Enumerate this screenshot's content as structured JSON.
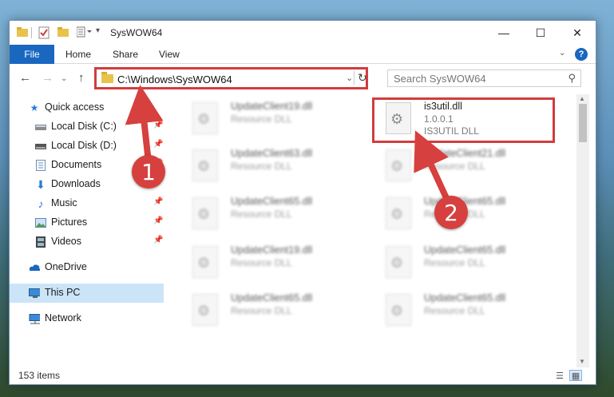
{
  "window": {
    "title": "SysWOW64",
    "controls": {
      "minimize": "—",
      "maximize": "☐",
      "close": "✕"
    }
  },
  "ribbon": {
    "tabs": [
      "File",
      "Home",
      "Share",
      "View"
    ],
    "help": "?"
  },
  "address": {
    "path": "C:\\Windows\\SysWOW64",
    "search_placeholder": "Search SysWOW64"
  },
  "nav": {
    "items": [
      {
        "label": "Quick access",
        "icon": "star-icon",
        "pinned": false
      },
      {
        "label": "Local Disk (C:)",
        "icon": "drive-icon",
        "pinned": true
      },
      {
        "label": "Local Disk (D:)",
        "icon": "drive-icon",
        "pinned": true
      },
      {
        "label": "Documents",
        "icon": "document-icon",
        "pinned": true
      },
      {
        "label": "Downloads",
        "icon": "download-icon",
        "pinned": true
      },
      {
        "label": "Music",
        "icon": "music-icon",
        "pinned": true
      },
      {
        "label": "Pictures",
        "icon": "picture-icon",
        "pinned": true
      },
      {
        "label": "Videos",
        "icon": "video-icon",
        "pinned": true
      },
      {
        "label": "OneDrive",
        "icon": "cloud-icon",
        "pinned": false
      },
      {
        "label": "This PC",
        "icon": "computer-icon",
        "pinned": false,
        "selected": true
      },
      {
        "label": "Network",
        "icon": "network-icon",
        "pinned": false
      }
    ]
  },
  "files": {
    "left": [
      {
        "name": "UpdateClient19.dll",
        "type": "Resource DLL"
      },
      {
        "name": "UpdateClient63.dll",
        "type": "Resource DLL"
      },
      {
        "name": "UpdateClient65.dll",
        "type": "Resource DLL"
      },
      {
        "name": "UpdateClient19.dll",
        "type": "Resource DLL"
      },
      {
        "name": "UpdateClient65.dll",
        "type": "Resource DLL"
      }
    ],
    "right": [
      {
        "name": "is3util.dll",
        "version": "1.0.0.1",
        "type": "IS3UTIL DLL"
      },
      {
        "name": "UpdateClient21.dll",
        "type": "Resource DLL"
      },
      {
        "name": "UpdateClient65.dll",
        "type": "Resource DLL"
      },
      {
        "name": "UpdateClient65.dll",
        "type": "Resource DLL"
      },
      {
        "name": "UpdateClient65.dll",
        "type": "Resource DLL"
      }
    ]
  },
  "status": {
    "item_count": "153 items"
  },
  "annotations": {
    "step1": "1",
    "step2": "2",
    "color": "#d23c3c"
  }
}
